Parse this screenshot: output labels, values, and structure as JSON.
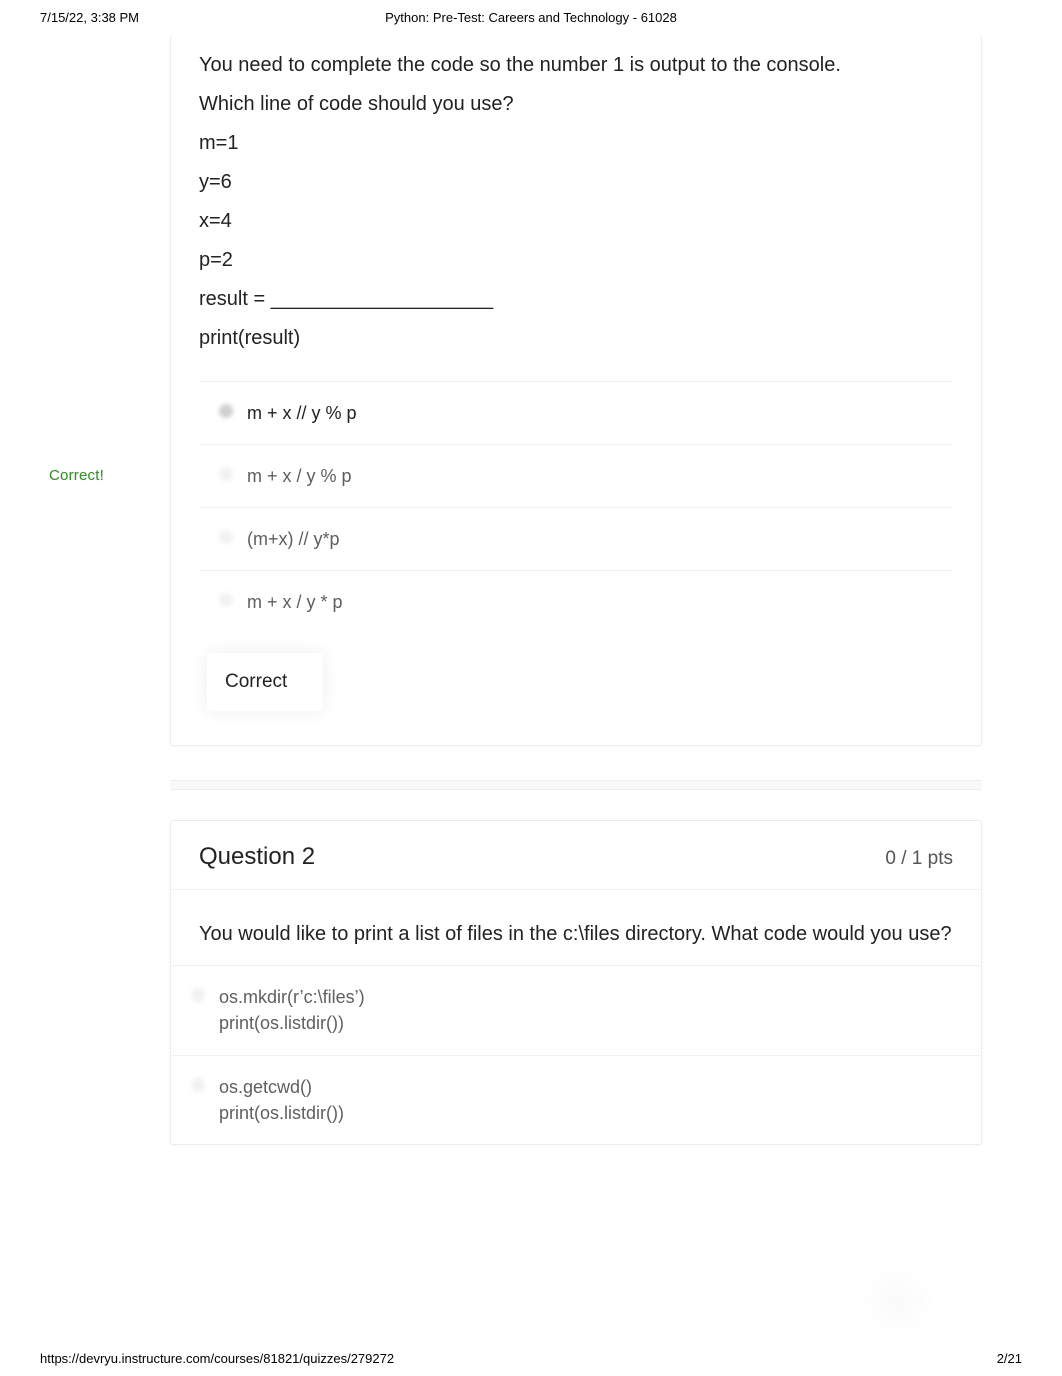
{
  "printHeader": {
    "datetime": "7/15/22, 3:38 PM",
    "title": "Python: Pre-Test: Careers and Technology - 61028"
  },
  "q1": {
    "p1": "You need to complete the code so the number 1 is output to the console.",
    "p2": "Which line of code should you use?",
    "c1": "m=1",
    "c2": "y=6",
    "c3": "x=4",
    "c4": "p=2",
    "c5": "result = ____________________",
    "c6": "print(result)",
    "gutter": "Correct!",
    "answers": [
      "m + x // y % p",
      "m + x / y % p",
      "(m+x) // y*p",
      "m + x / y * p"
    ],
    "feedback": "Correct"
  },
  "q2": {
    "title": "Question 2",
    "points": "0 / 1 pts",
    "prompt": "You would like to print a list of files in the c:\\files directory. What code would you use?",
    "answers": [
      "os.mkdir(r’c:\\files’)\nprint(os.listdir())",
      "os.getcwd()\nprint(os.listdir())"
    ]
  },
  "printFooter": {
    "url": "https://devryu.instructure.com/courses/81821/quizzes/279272",
    "page": "2/21"
  }
}
